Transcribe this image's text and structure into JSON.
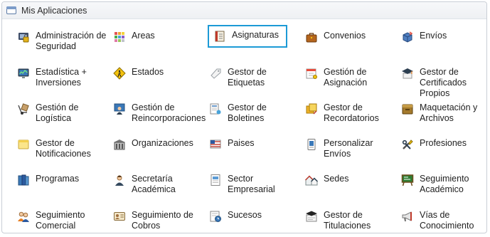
{
  "panel": {
    "title": "Mis Aplicaciones"
  },
  "apps": [
    {
      "label": "Administración de Seguridad",
      "icon": "security-admin-icon"
    },
    {
      "label": "Areas",
      "icon": "areas-grid-icon"
    },
    {
      "label": "Asignaturas",
      "icon": "notebook-icon",
      "selected": true
    },
    {
      "label": "Convenios",
      "icon": "briefcase-icon"
    },
    {
      "label": "Envíos",
      "icon": "package-arrow-icon"
    },
    {
      "label": "Estadística + Inversiones",
      "icon": "monitor-chart-icon"
    },
    {
      "label": "Estados",
      "icon": "road-sign-icon"
    },
    {
      "label": "Gestor de Etiquetas",
      "icon": "tag-icon"
    },
    {
      "label": "Gestión de Asignación",
      "icon": "calendar-pin-icon"
    },
    {
      "label": "Gestor de Certificados Propios",
      "icon": "graduation-cap-icon"
    },
    {
      "label": "Gestión de Logística",
      "icon": "hand-truck-icon"
    },
    {
      "label": "Gestión de Reincorporaciones",
      "icon": "user-board-icon"
    },
    {
      "label": "Gestor de Boletines",
      "icon": "newsletter-icon"
    },
    {
      "label": "Gestor de Recordatorios",
      "icon": "sticky-notes-icon"
    },
    {
      "label": "Maquetación y Archivos",
      "icon": "archive-box-icon"
    },
    {
      "label": "Gestor de Notificaciones",
      "icon": "note-icon"
    },
    {
      "label": "Organizaciones",
      "icon": "building-icon"
    },
    {
      "label": "Paises",
      "icon": "flag-icon"
    },
    {
      "label": "Personalizar Envíos",
      "icon": "envelope-doc-icon"
    },
    {
      "label": "Profesiones",
      "icon": "tools-icon"
    },
    {
      "label": "Programas",
      "icon": "books-icon"
    },
    {
      "label": "Secretaría Académica",
      "icon": "secretary-icon"
    },
    {
      "label": "Sector Empresarial",
      "icon": "office-document-icon"
    },
    {
      "label": "Sedes",
      "icon": "houses-icon"
    },
    {
      "label": "Seguimiento Académico",
      "icon": "chalkboard-icon"
    },
    {
      "label": "Seguimiento Comercial",
      "icon": "users-icon"
    },
    {
      "label": "Seguimiento de Cobros",
      "icon": "id-card-icon"
    },
    {
      "label": "Sucesos",
      "icon": "event-clock-icon"
    },
    {
      "label": "Gestor de Titulaciones",
      "icon": "certificate-icon"
    },
    {
      "label": "Vías de Conocimiento",
      "icon": "megaphone-icon"
    }
  ]
}
